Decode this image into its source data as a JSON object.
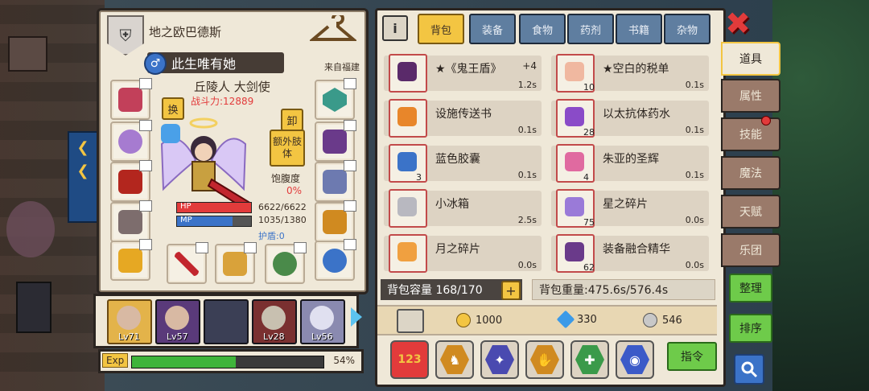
{
  "character": {
    "guild_name": "地之欧巴德斯",
    "name": "此生唯有她",
    "origin": "来自福建",
    "title": "丘陵人 大剑使",
    "power": "战斗力:12889",
    "swap_label": "换",
    "unequip_label": "卸",
    "extra_limbs_label": "额外肢体",
    "satiety_label": "饱腹度",
    "satiety_value": "0%",
    "hp_label": "HP",
    "mp_label": "MP",
    "hp": "6622/6622",
    "mp": "1035/1380",
    "hp_fraction": 1.0,
    "mp_fraction": 0.75,
    "shield": "护盾:0"
  },
  "party": [
    {
      "level": "Lv71"
    },
    {
      "level": "Lv57"
    },
    {
      "level": ""
    },
    {
      "level": "Lv28"
    },
    {
      "level": "Lv56"
    }
  ],
  "exp": {
    "label": "Exp",
    "percent": "54%",
    "fraction": 0.54
  },
  "inventory": {
    "tabs": [
      "背包",
      "装备",
      "食物",
      "药剂",
      "书籍",
      "杂物"
    ],
    "active_tab": "背包",
    "items": [
      {
        "name": "★《鬼王盾》",
        "plus": "+4",
        "time": "1.2s",
        "count": "",
        "color": "#5a2a6a"
      },
      {
        "name": "★空白的税单",
        "plus": "",
        "time": "0.1s",
        "count": "10",
        "color": "#f0b8a0"
      },
      {
        "name": "设施传送书",
        "plus": "",
        "time": "0.1s",
        "count": "",
        "color": "#e8862a"
      },
      {
        "name": "以太抗体药水",
        "plus": "",
        "time": "0.1s",
        "count": "28",
        "color": "#8a4bc8"
      },
      {
        "name": "蓝色胶囊",
        "plus": "",
        "time": "0.1s",
        "count": "3",
        "color": "#3b73c8"
      },
      {
        "name": "朱亚的圣辉",
        "plus": "",
        "time": "0.1s",
        "count": "4",
        "color": "#e06aa0"
      },
      {
        "name": "小冰箱",
        "plus": "",
        "time": "2.5s",
        "count": "",
        "color": "#b8b8c0"
      },
      {
        "name": "星之碎片",
        "plus": "",
        "time": "0.0s",
        "count": "75",
        "color": "#9a7ad8"
      },
      {
        "name": "月之碎片",
        "plus": "",
        "time": "0.0s",
        "count": "",
        "color": "#f0a040"
      },
      {
        "name": "装备融合精华",
        "plus": "",
        "time": "0.0s",
        "count": "62",
        "color": "#6a3a8a"
      }
    ],
    "capacity": "背包容量 168/170",
    "weight": "背包重量:475.6s/576.4s",
    "gold": "1000",
    "diamond": "330",
    "silver": "546",
    "command_label": "指令"
  },
  "side_tabs": [
    "道具",
    "属性",
    "技能",
    "魔法",
    "天赋",
    "乐团"
  ],
  "side_buttons": {
    "tidy": "整理",
    "sort": "排序"
  },
  "colors": {
    "gold": "#f3c542",
    "hp": "#e23b3b",
    "mp": "#3b73c8",
    "exp": "#3fb43a"
  }
}
